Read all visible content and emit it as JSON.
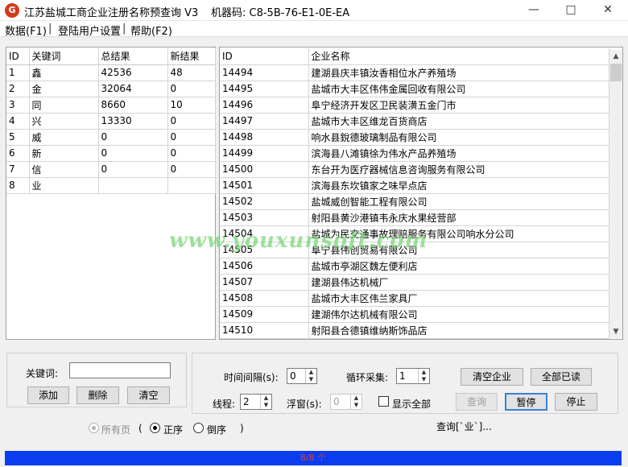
{
  "window": {
    "title": "江苏盐城工商企业注册名称预查询 V3",
    "machine_code": "机器码: C8-5B-76-E1-0E-EA",
    "icon_text": "G"
  },
  "menu": [
    "数据(F1)",
    "登陆用户设置",
    "帮助(F2)"
  ],
  "keywords": {
    "columns": [
      "ID",
      "关键词",
      "总结果",
      "新结果"
    ],
    "rows": [
      [
        "1",
        "鑫",
        "42536",
        "48"
      ],
      [
        "2",
        "金",
        "32064",
        "0"
      ],
      [
        "3",
        "同",
        "8660",
        "10"
      ],
      [
        "4",
        "兴",
        "13330",
        "0"
      ],
      [
        "5",
        "威",
        "0",
        "0"
      ],
      [
        "6",
        "新",
        "0",
        "0"
      ],
      [
        "7",
        "信",
        "0",
        "0"
      ],
      [
        "8",
        "业",
        "",
        ""
      ]
    ]
  },
  "companies": {
    "columns": [
      "ID",
      "企业名称"
    ],
    "rows": [
      [
        "14494",
        "建湖县庆丰镇汝香相位水产养殖场"
      ],
      [
        "14495",
        "盐城市大丰区伟伟金属回收有限公司"
      ],
      [
        "14496",
        "阜宁经济开发区卫民装潢五金门市"
      ],
      [
        "14497",
        "盐城市大丰区维龙百货商店"
      ],
      [
        "14498",
        "响水县銳德玻璃制品有限公司"
      ],
      [
        "14499",
        "滨海县八滩镇徐为伟水产品养殖场"
      ],
      [
        "14500",
        "东台开为医疗器械信息咨询服务有限公司"
      ],
      [
        "14501",
        "滨海县东坎镇家之味早点店"
      ],
      [
        "14502",
        "盐城威创智能工程有限公司"
      ],
      [
        "14503",
        "射阳县黄沙港镇韦永庆水果经营部"
      ],
      [
        "14504",
        "盐城为民交通事故理赔服务有限公司响水分公司"
      ],
      [
        "14505",
        "阜宁县伟创贸易有限公司"
      ],
      [
        "14506",
        "盐城市亭湖区魏左便利店"
      ],
      [
        "14507",
        "建湖县伟达机械厂"
      ],
      [
        "14508",
        "盐城市大丰区伟兰家具厂"
      ],
      [
        "14509",
        "建湖伟尔达机械有限公司"
      ],
      [
        "14510",
        "射阳县合德镇维纳斯饰品店"
      ]
    ]
  },
  "watermark": "www.youxunsoft.com",
  "controls": {
    "keyword_label": "关键词:",
    "keyword_value": "",
    "add": "添加",
    "delete": "删除",
    "clear": "清空",
    "interval_label": "时间间隔(s):",
    "interval_value": "0",
    "loop_label": "循环采集:",
    "loop_value": "1",
    "threads_label": "线程:",
    "threads_value": "2",
    "float_label": "浮窗(s):",
    "float_value": "0",
    "show_all_label": "显示全部",
    "clear_companies": "清空企业",
    "all_read": "全部已读",
    "query": "查询",
    "pause": "暂停",
    "stop": "停止",
    "all_pages": "所有页",
    "paren_open": "(",
    "ascending": "正序",
    "descending": "倒序",
    "paren_close": ")",
    "status_text": "查询[`业`]...",
    "progress": "8/8 个"
  }
}
